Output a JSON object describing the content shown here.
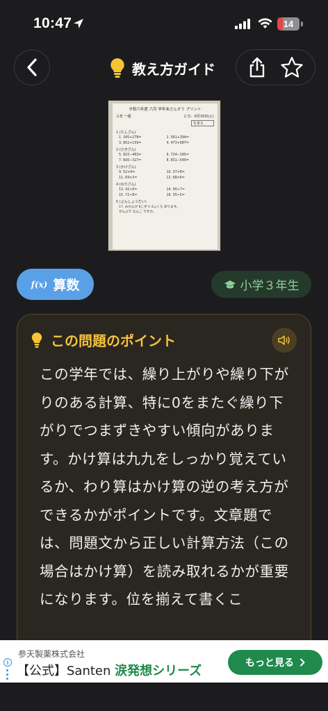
{
  "status_bar": {
    "time": "10:47",
    "battery": "14"
  },
  "header": {
    "title": "教え方ガイド",
    "bulb_icon": "lightbulb-icon",
    "accent": "#f5c33c"
  },
  "thumbnail": {
    "sheet_title": "令和六年度 六月 学年末さんすう プリント",
    "sheet_subtitle": "三年 一組",
    "sheet_name_label": "なまえ",
    "sheet_date": "にち：6月18日(火)",
    "sections": [
      {
        "label": "1 (たしざん)",
        "items": [
          "1. 345+278=",
          "2. 561+394=",
          "3. 802+159=",
          "4. 473+687="
        ]
      },
      {
        "label": "2 (ひきざん)",
        "items": [
          "5. 910−463=",
          "6. 724−185=",
          "7. 600−327=",
          "8. 831−549="
        ]
      },
      {
        "label": "3 (かけざん)",
        "items": [
          "9. 52×4=",
          "10. 37×8=",
          "11. 69×3=",
          "12. 68×6="
        ]
      },
      {
        "label": "4 (わりざん)",
        "items": [
          "13. 42÷6=",
          "14. 56÷7=",
          "15. 72÷8=",
          "16. 35÷5="
        ]
      },
      {
        "label": "5 (ぶんしょうだい)",
        "items": [
          "17. みかんが 8こずつ 4ふくろ あります。",
          "ぜんぶで なんこ ですか。"
        ]
      }
    ]
  },
  "tags": {
    "subject_icon": "f(x)",
    "subject": "算数",
    "subject_color": "#5aa0e6",
    "grade": "小学３年生",
    "grade_icon": "graduation-cap-icon",
    "grade_color": "#8fd19b"
  },
  "point_card": {
    "title": "この問題のポイント",
    "body": "この学年では、繰り上がりや繰り下がりのある計算、特に0をまたぐ繰り下がりでつまずきやすい傾向があります。かけ算は九九をしっかり覚えているか、わり算はかけ算の逆の考え方ができるかがポイントです。文章題では、問題文から正しい計算方法（この場合はかけ算）を読み取れるかが重要になります。位を揃えて書くこ"
  },
  "ad": {
    "company": "参天製薬株式会社",
    "headline_prefix": "【公式】Santen",
    "headline_highlight": "涙発想シリーズ",
    "cta_label": "もっと見る",
    "cta_color": "#1f8a4c"
  }
}
